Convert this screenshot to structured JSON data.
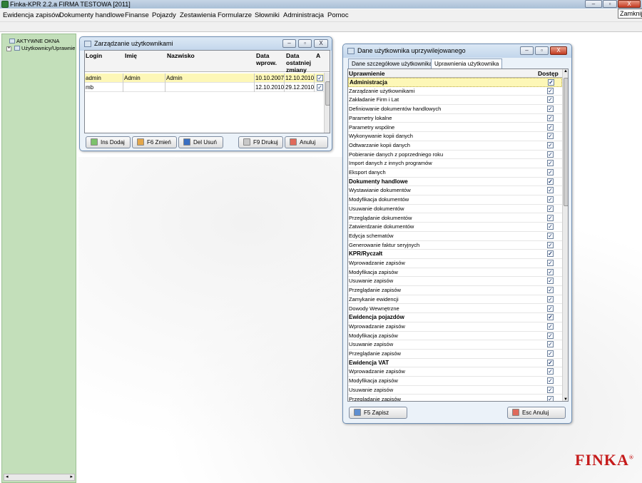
{
  "app": {
    "title": "Finka-KPR 2.2.a FIRMA TESTOWA [2011]",
    "tooltip": "Zamknij",
    "min": "–",
    "max": "▫",
    "close": "X"
  },
  "menu": [
    "Ewidencja zapisów",
    "Dokumenty handlowe",
    "Finanse",
    "Pojazdy",
    "Zestawienia",
    "Formularze",
    "Słowniki",
    "Administracja",
    "Pomoc"
  ],
  "left_panel": {
    "root": "AKTYWNE OKNA",
    "child": "Użytkownicy/Uprawnie",
    "plus": "+",
    "scroll_left": "◂",
    "scroll_right": "▸"
  },
  "users_window": {
    "title": "Zarządzanie użytkownikami",
    "headers": [
      "Login",
      "Imię",
      "Nazwisko",
      "Data wprow.",
      "Data ostatniej zmiany",
      "A"
    ],
    "rows": [
      {
        "login": "admin",
        "first": "Admin",
        "last": "Admin",
        "created": "10.10.2007",
        "changed": "12.10.2010",
        "active": "✓"
      },
      {
        "login": "mb",
        "first": "",
        "last": "",
        "created": "12.10.2010",
        "changed": "29.12.2010",
        "active": "✓"
      }
    ],
    "buttons": {
      "add": "Ins Dodaj",
      "edit": "F6 Zmień",
      "delete": "Del Usuń",
      "print": "F9 Drukuj",
      "cancel": "Anuluj"
    }
  },
  "perm_window": {
    "title": "Dane użytkownika uprzywilejowanego",
    "tabs": [
      "Dane szczegółowe użytkownika",
      "Uprawnienia użytkownika"
    ],
    "col_perm": "Uprawnienie",
    "col_access": "Dostęp",
    "items": [
      {
        "label": "Administracja",
        "bold": true,
        "checked": "✓"
      },
      {
        "label": "Zarządzanie użytkownikami",
        "bold": false,
        "checked": "✓"
      },
      {
        "label": "Zakładanie Firm i Lat",
        "bold": false,
        "checked": "✓"
      },
      {
        "label": "Definiowanie dokumentów handlowych",
        "bold": false,
        "checked": "✓"
      },
      {
        "label": "Parametry lokalne",
        "bold": false,
        "checked": "✓"
      },
      {
        "label": "Parametry wspólne",
        "bold": false,
        "checked": "✓"
      },
      {
        "label": "Wykonywanie kopii danych",
        "bold": false,
        "checked": "✓"
      },
      {
        "label": "Odtwarzanie kopii danych",
        "bold": false,
        "checked": "✓"
      },
      {
        "label": "Pobieranie danych z poprzedniego roku",
        "bold": false,
        "checked": "✓"
      },
      {
        "label": "Import danych z innych programów",
        "bold": false,
        "checked": "✓"
      },
      {
        "label": "Eksport danych",
        "bold": false,
        "checked": "✓"
      },
      {
        "label": "Dokumenty handlowe",
        "bold": true,
        "checked": "✓"
      },
      {
        "label": "Wystawianie dokumentów",
        "bold": false,
        "checked": "✓"
      },
      {
        "label": "Modyfikacja dokumentów",
        "bold": false,
        "checked": "✓"
      },
      {
        "label": "Usuwanie dokumentów",
        "bold": false,
        "checked": "✓"
      },
      {
        "label": "Przeglądanie dokumentów",
        "bold": false,
        "checked": "✓"
      },
      {
        "label": "Zatwierdzanie dokumentów",
        "bold": false,
        "checked": "✓"
      },
      {
        "label": "Edycja schematów",
        "bold": false,
        "checked": "✓"
      },
      {
        "label": "Generowanie faktur seryjnych",
        "bold": false,
        "checked": "✓"
      },
      {
        "label": "KPR/Ryczałt",
        "bold": true,
        "checked": "✓"
      },
      {
        "label": "Wprowadzanie zapisów",
        "bold": false,
        "checked": "✓"
      },
      {
        "label": "Modyfikacja zapisów",
        "bold": false,
        "checked": "✓"
      },
      {
        "label": "Usuwanie zapisów",
        "bold": false,
        "checked": "✓"
      },
      {
        "label": "Przeglądanie zapisów",
        "bold": false,
        "checked": "✓"
      },
      {
        "label": "Zamykanie ewidencji",
        "bold": false,
        "checked": "✓"
      },
      {
        "label": "Dowody Wewnętrzne",
        "bold": false,
        "checked": "✓"
      },
      {
        "label": "Ewidencja pojazdów",
        "bold": true,
        "checked": "✓"
      },
      {
        "label": "Wprowadzanie zapisów",
        "bold": false,
        "checked": "✓"
      },
      {
        "label": "Modyfikacja zapisów",
        "bold": false,
        "checked": "✓"
      },
      {
        "label": "Usuwanie zapisów",
        "bold": false,
        "checked": "✓"
      },
      {
        "label": "Przeglądanie zapisów",
        "bold": false,
        "checked": "✓"
      },
      {
        "label": "Ewidencja VAT",
        "bold": true,
        "checked": "✓"
      },
      {
        "label": "Wprowadzanie zapisów",
        "bold": false,
        "checked": "✓"
      },
      {
        "label": "Modyfikacja zapisów",
        "bold": false,
        "checked": "✓"
      },
      {
        "label": "Usuwanie zapisów",
        "bold": false,
        "checked": "✓"
      },
      {
        "label": "Przeglądanie zapisów",
        "bold": false,
        "checked": "✓"
      }
    ],
    "buttons": {
      "save": "F5 Zapisz",
      "cancel": "Esc Anuluj"
    }
  },
  "brand": {
    "logo": "FINKA",
    "reg": "®"
  },
  "colors": {
    "left_panel": "#c3dfba",
    "selected_row": "#fdf7b7",
    "brand_red": "#c51b1b",
    "title_blue": "#c2d6eb"
  }
}
